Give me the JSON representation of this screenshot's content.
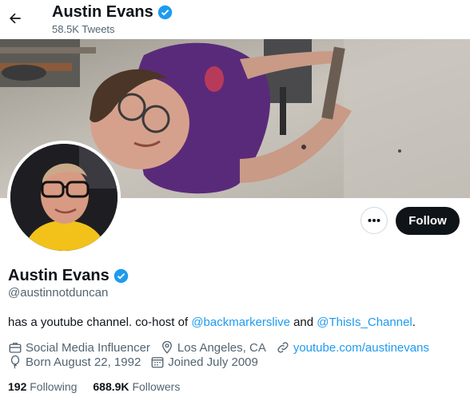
{
  "header": {
    "name": "Austin Evans",
    "tweets": "58.5K Tweets"
  },
  "profile": {
    "name": "Austin Evans",
    "handle": "@austinnotduncan",
    "bio_prefix": "has a youtube channel. co-host of ",
    "bio_link1": "@backmarkerslive",
    "bio_mid": " and ",
    "bio_link2": "@ThisIs_Channel",
    "bio_suffix": ".",
    "category": "Social Media Influencer",
    "location": "Los Angeles, CA",
    "website": "youtube.com/austinevans",
    "birthday": "Born August 22, 1992",
    "joined": "Joined July 2009"
  },
  "actions": {
    "more": "•••",
    "follow": "Follow"
  },
  "stats": {
    "following_count": "192",
    "following_label": "Following",
    "followers_count": "688.9K",
    "followers_label": "Followers"
  },
  "colors": {
    "accent": "#1d9bf0",
    "text": "#0f1419",
    "secondary": "#536471",
    "follow_bg": "#0f1419"
  },
  "icons": [
    "back-arrow-icon",
    "verified-badge-icon",
    "more-icon",
    "briefcase-icon",
    "location-pin-icon",
    "link-icon",
    "balloon-icon",
    "calendar-icon"
  ]
}
